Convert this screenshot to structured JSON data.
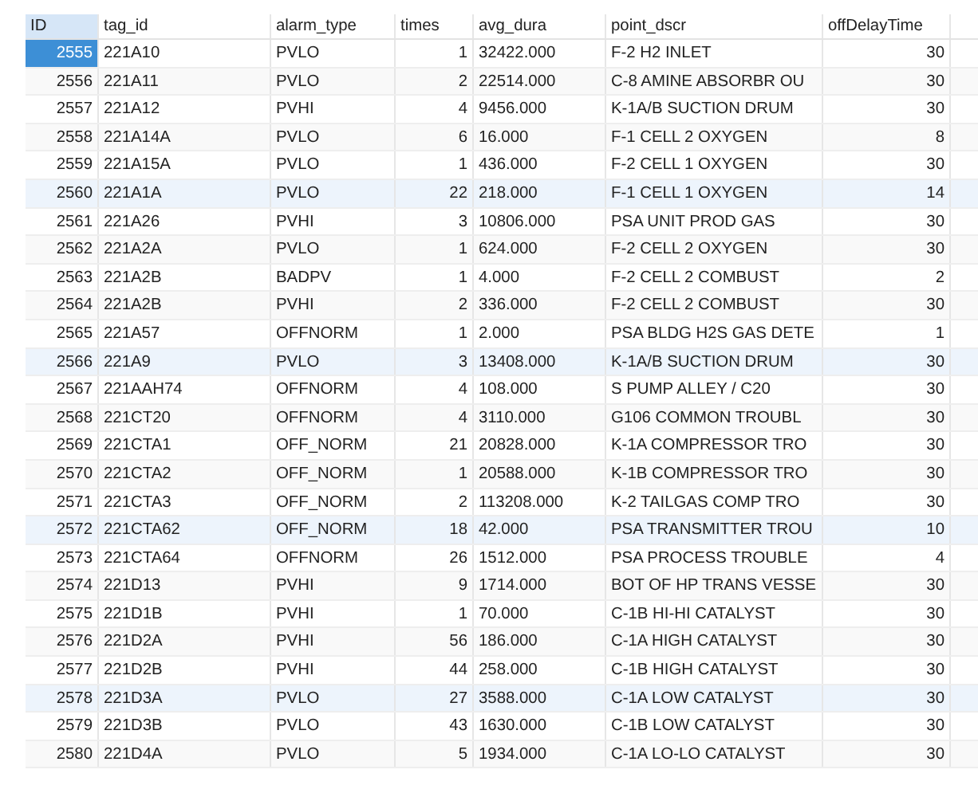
{
  "table": {
    "columns": [
      "ID",
      "tag_id",
      "alarm_type",
      "times",
      "avg_dura",
      "point_dscr",
      "offDelayTime"
    ],
    "rows": [
      {
        "cells": [
          "2555",
          "221A10",
          "PVLO",
          "1",
          "32422.000",
          "F-2 H2 INLET",
          "30"
        ],
        "selected": true,
        "highlighted": false
      },
      {
        "cells": [
          "2556",
          "221A11",
          "PVLO",
          "2",
          "22514.000",
          "C-8 AMINE ABSORBR OU",
          "30"
        ],
        "selected": false,
        "highlighted": false
      },
      {
        "cells": [
          "2557",
          "221A12",
          "PVHI",
          "4",
          "9456.000",
          "K-1A/B SUCTION DRUM",
          "30"
        ],
        "selected": false,
        "highlighted": false
      },
      {
        "cells": [
          "2558",
          "221A14A",
          "PVLO",
          "6",
          "16.000",
          "F-1 CELL 2 OXYGEN",
          "8"
        ],
        "selected": false,
        "highlighted": false
      },
      {
        "cells": [
          "2559",
          "221A15A",
          "PVLO",
          "1",
          "436.000",
          "F-2 CELL 1 OXYGEN",
          "30"
        ],
        "selected": false,
        "highlighted": false
      },
      {
        "cells": [
          "2560",
          "221A1A",
          "PVLO",
          "22",
          "218.000",
          "F-1 CELL 1 OXYGEN",
          "14"
        ],
        "selected": false,
        "highlighted": true
      },
      {
        "cells": [
          "2561",
          "221A26",
          "PVHI",
          "3",
          "10806.000",
          "PSA UNIT PROD GAS",
          "30"
        ],
        "selected": false,
        "highlighted": false
      },
      {
        "cells": [
          "2562",
          "221A2A",
          "PVLO",
          "1",
          "624.000",
          "F-2 CELL 2 OXYGEN",
          "30"
        ],
        "selected": false,
        "highlighted": false
      },
      {
        "cells": [
          "2563",
          "221A2B",
          "BADPV",
          "1",
          "4.000",
          "F-2 CELL 2 COMBUST",
          "2"
        ],
        "selected": false,
        "highlighted": false
      },
      {
        "cells": [
          "2564",
          "221A2B",
          "PVHI",
          "2",
          "336.000",
          "F-2 CELL 2 COMBUST",
          "30"
        ],
        "selected": false,
        "highlighted": false
      },
      {
        "cells": [
          "2565",
          "221A57",
          "OFFNORM",
          "1",
          "2.000",
          "PSA BLDG H2S GAS DETE",
          "1"
        ],
        "selected": false,
        "highlighted": false
      },
      {
        "cells": [
          "2566",
          "221A9",
          "PVLO",
          "3",
          "13408.000",
          "K-1A/B SUCTION DRUM",
          "30"
        ],
        "selected": false,
        "highlighted": true
      },
      {
        "cells": [
          "2567",
          "221AAH74",
          "OFFNORM",
          "4",
          "108.000",
          "S PUMP ALLEY / C20",
          "30"
        ],
        "selected": false,
        "highlighted": false
      },
      {
        "cells": [
          "2568",
          "221CT20",
          "OFFNORM",
          "4",
          "3110.000",
          "G106 COMMON TROUBL",
          "30"
        ],
        "selected": false,
        "highlighted": false
      },
      {
        "cells": [
          "2569",
          "221CTA1",
          "OFF_NORM",
          "21",
          "20828.000",
          "K-1A COMPRESSOR TRO",
          "30"
        ],
        "selected": false,
        "highlighted": false
      },
      {
        "cells": [
          "2570",
          "221CTA2",
          "OFF_NORM",
          "1",
          "20588.000",
          "K-1B COMPRESSOR TRO",
          "30"
        ],
        "selected": false,
        "highlighted": false
      },
      {
        "cells": [
          "2571",
          "221CTA3",
          "OFF_NORM",
          "2",
          "113208.000",
          "K-2 TAILGAS COMP TRO",
          "30"
        ],
        "selected": false,
        "highlighted": false
      },
      {
        "cells": [
          "2572",
          "221CTA62",
          "OFF_NORM",
          "18",
          "42.000",
          "PSA TRANSMITTER TROU",
          "10"
        ],
        "selected": false,
        "highlighted": true
      },
      {
        "cells": [
          "2573",
          "221CTA64",
          "OFFNORM",
          "26",
          "1512.000",
          "PSA PROCESS TROUBLE",
          "4"
        ],
        "selected": false,
        "highlighted": false
      },
      {
        "cells": [
          "2574",
          "221D13",
          "PVHI",
          "9",
          "1714.000",
          "BOT OF HP TRANS VESSE",
          "30"
        ],
        "selected": false,
        "highlighted": false
      },
      {
        "cells": [
          "2575",
          "221D1B",
          "PVHI",
          "1",
          "70.000",
          "C-1B HI-HI CATALYST",
          "30"
        ],
        "selected": false,
        "highlighted": false
      },
      {
        "cells": [
          "2576",
          "221D2A",
          "PVHI",
          "56",
          "186.000",
          "C-1A HIGH CATALYST",
          "30"
        ],
        "selected": false,
        "highlighted": false
      },
      {
        "cells": [
          "2577",
          "221D2B",
          "PVHI",
          "44",
          "258.000",
          "C-1B HIGH CATALYST",
          "30"
        ],
        "selected": false,
        "highlighted": false
      },
      {
        "cells": [
          "2578",
          "221D3A",
          "PVLO",
          "27",
          "3588.000",
          "C-1A LOW CATALYST",
          "30"
        ],
        "selected": false,
        "highlighted": true
      },
      {
        "cells": [
          "2579",
          "221D3B",
          "PVLO",
          "43",
          "1630.000",
          "C-1B LOW CATALYST",
          "30"
        ],
        "selected": false,
        "highlighted": false
      },
      {
        "cells": [
          "2580",
          "221D4A",
          "PVLO",
          "5",
          "1934.000",
          "C-1A LO-LO CATALYST",
          "30"
        ],
        "selected": false,
        "highlighted": false
      }
    ]
  }
}
